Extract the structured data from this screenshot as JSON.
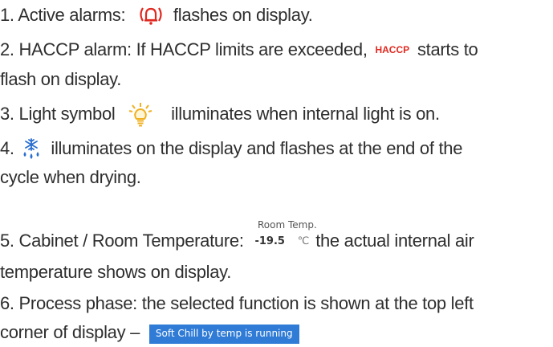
{
  "lines": {
    "l1a": "1. Active alarms:",
    "l1b": "flashes on display.",
    "l2a": "2. HACCP alarm: If HACCP limits are exceeded,",
    "l2b": "starts to",
    "l3": "flash on display.",
    "l4a": "3. Light symbol",
    "l4b": "illuminates when internal light is on.",
    "l5a": "4.",
    "l5b": "illuminates on the display and flashes at the end of the",
    "l6": "cycle when drying.",
    "l7a": "5. Cabinet / Room Temperature:",
    "l7b": "the actual internal air",
    "l8": "temperature shows on display.",
    "l9": "6. Process phase: the selected function is shown at the top left",
    "l10": "corner of display –"
  },
  "haccp_label": "HACCP",
  "room_temp": {
    "label": "Room Temp.",
    "value": "-19.5",
    "unit": "℃"
  },
  "process_badge": "Soft Chill by temp is running",
  "icons": {
    "alarm": "alarm-bell-icon",
    "light": "light-bulb-icon",
    "defrost": "snowflake-drip-icon"
  },
  "colors": {
    "text": "#2e2e2e",
    "haccp": "#e0281f",
    "alarm": "#e0281f",
    "light": "#f0b020",
    "snow": "#2a6fd0",
    "badge": "#2f7bd6"
  }
}
